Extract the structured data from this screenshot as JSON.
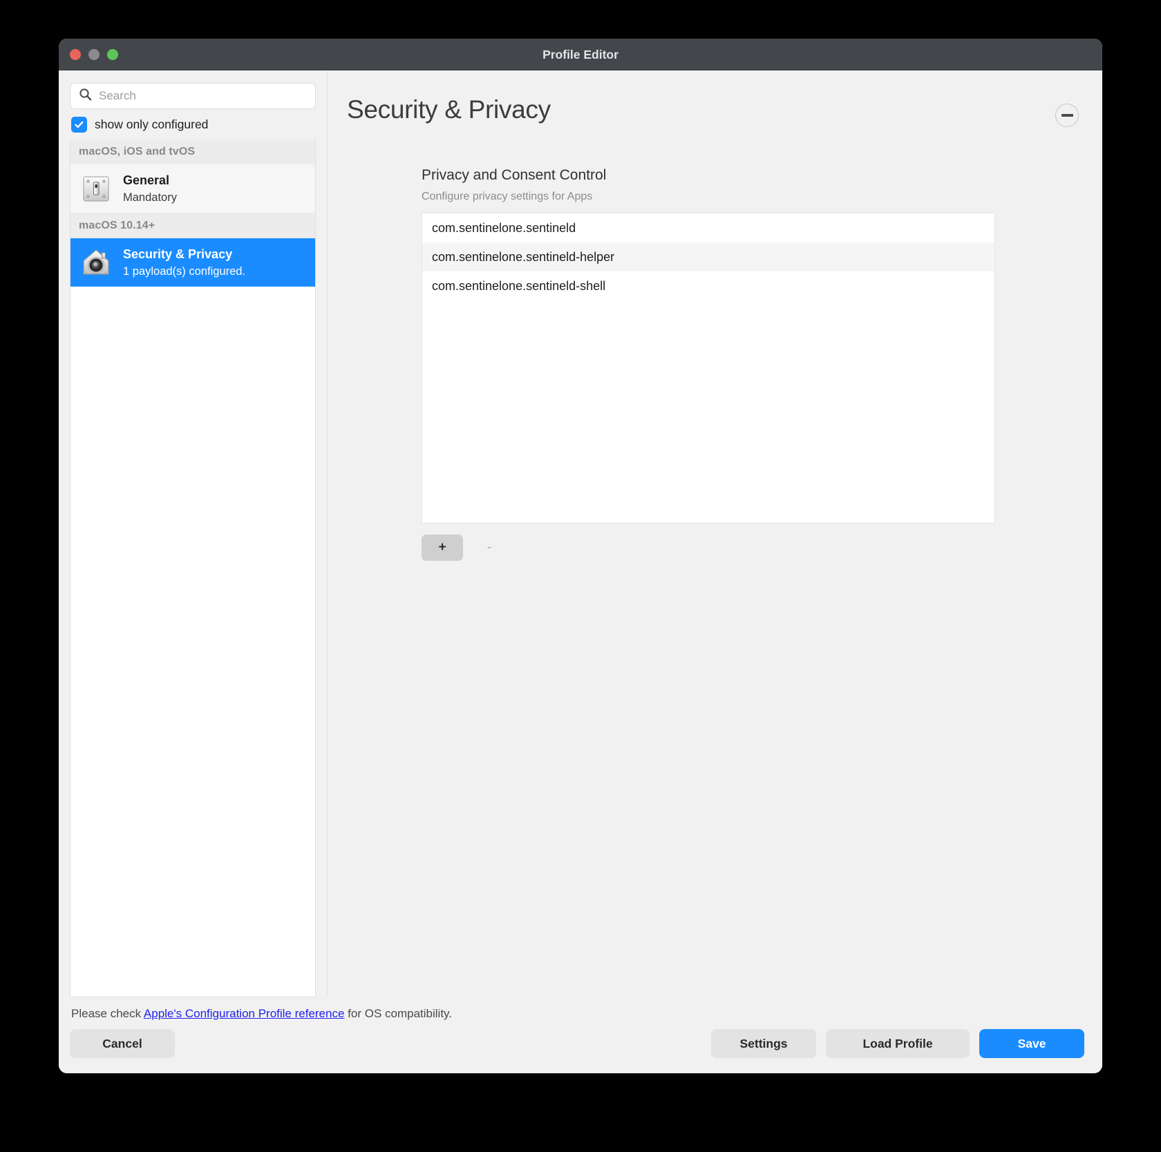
{
  "window": {
    "title": "Profile Editor",
    "traffic_lights": [
      "close",
      "minimize",
      "zoom"
    ],
    "colors": {
      "titlebar": "#43474b",
      "accent": "#1a8cff",
      "link": "#2020ee"
    }
  },
  "sidebar": {
    "search": {
      "placeholder": "Search",
      "value": "",
      "icon": "search-icon"
    },
    "filter_checkbox": {
      "label": "show only configured",
      "checked": true
    },
    "groups": [
      {
        "header": "macOS, iOS and tvOS",
        "items": [
          {
            "title": "General",
            "subtitle": "Mandatory",
            "icon": "light-switch-icon",
            "selected": false
          }
        ]
      },
      {
        "header": "macOS 10.14+",
        "items": [
          {
            "title": "Security & Privacy",
            "subtitle": "1 payload(s) configured.",
            "icon": "house-lock-icon",
            "selected": true
          }
        ]
      }
    ]
  },
  "main": {
    "page_title": "Security & Privacy",
    "remove_payload_icon": "minus-circle-icon",
    "section": {
      "title": "Privacy and Consent Control",
      "subtitle": "Configure privacy settings for Apps",
      "rows": [
        "com.sentinelone.sentineld",
        "com.sentinelone.sentineld-helper",
        "com.sentinelone.sentineld-shell"
      ],
      "add_label": "+",
      "remove_label": "-"
    }
  },
  "footer": {
    "note_prefix": "Please check ",
    "note_link": "Apple's Configuration Profile reference",
    "note_suffix": " for OS compatibility.",
    "cancel_label": "Cancel",
    "settings_label": "Settings",
    "load_profile_label": "Load Profile",
    "save_label": "Save"
  }
}
